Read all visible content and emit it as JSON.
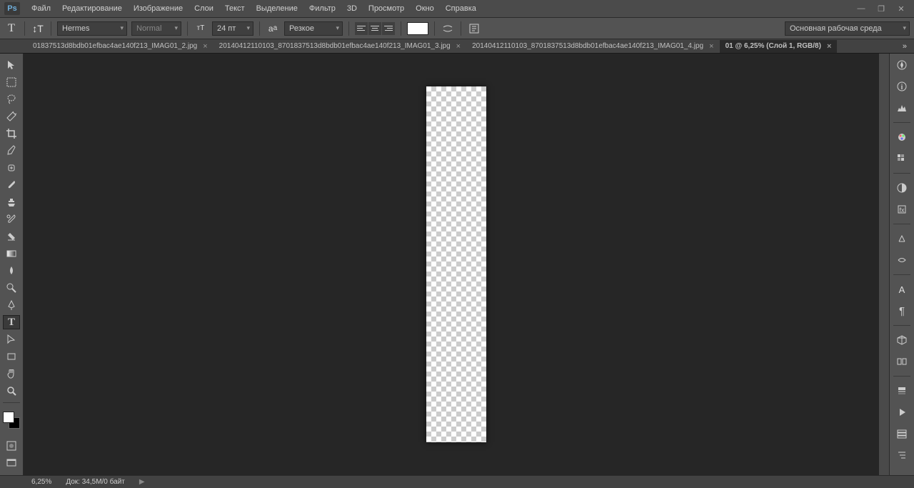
{
  "menu": [
    "Файл",
    "Редактирование",
    "Изображение",
    "Слои",
    "Текст",
    "Выделение",
    "Фильтр",
    "3D",
    "Просмотр",
    "Окно",
    "Справка"
  ],
  "options": {
    "font_family": "Hermes",
    "font_style": "Normal",
    "font_size": "24 пт",
    "antialias": "Резкое",
    "workspace": "Основная рабочая среда"
  },
  "tabs": [
    {
      "label": "01837513d8bdb01efbac4ae140f213_IMAG01_2.jpg",
      "active": false
    },
    {
      "label": "20140412110103_8701837513d8bdb01efbac4ae140f213_IMAG01_3.jpg",
      "active": false
    },
    {
      "label": "20140412110103_8701837513d8bdb01efbac4ae140f213_IMAG01_4.jpg",
      "active": false
    },
    {
      "label": "01 @ 6,25% (Слой 1, RGB/8)",
      "active": true
    }
  ],
  "status": {
    "zoom": "6,25%",
    "doc_info": "Док: 34,5M/0 байт"
  }
}
